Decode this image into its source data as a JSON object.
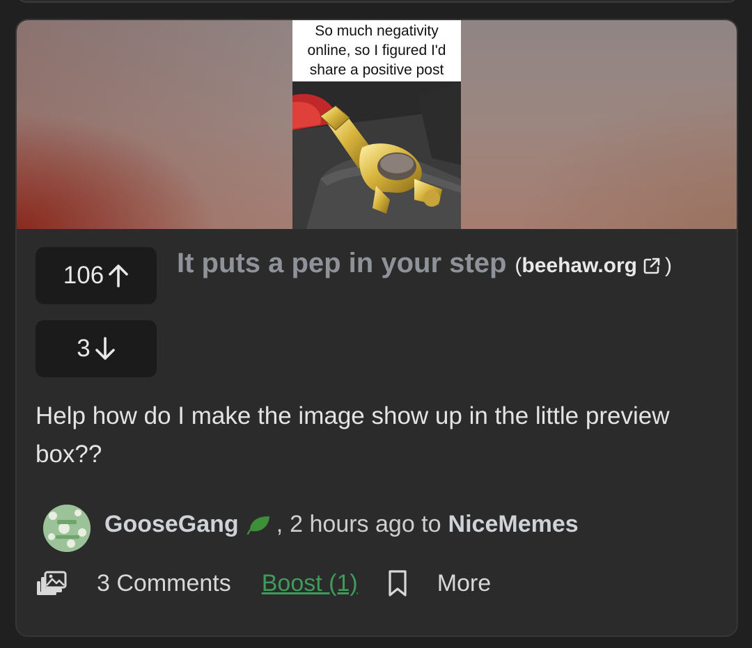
{
  "post": {
    "image_caption": "So much negativity online, so I figured I'd share a positive post",
    "upvotes": "106",
    "downvotes": "3",
    "title": "It puts a pep in your step",
    "domain": "beehaw.org",
    "body": "Help how do I make the image show up in the little preview box??",
    "author": "GooseGang",
    "separator": ",",
    "time_text": "2 hours ago to",
    "community": "NiceMemes"
  },
  "actions": {
    "comments": "3 Comments",
    "boost": "Boost (1)",
    "more": "More"
  },
  "colors": {
    "boost": "#3d9c5a",
    "leaf": "#3e8f3a",
    "title": "#8f9399",
    "card": "#2b2b2b"
  },
  "icons": [
    "arrow-up-icon",
    "arrow-down-icon",
    "external-link-icon",
    "leaf-icon",
    "crosspost-icon",
    "bookmark-icon"
  ]
}
